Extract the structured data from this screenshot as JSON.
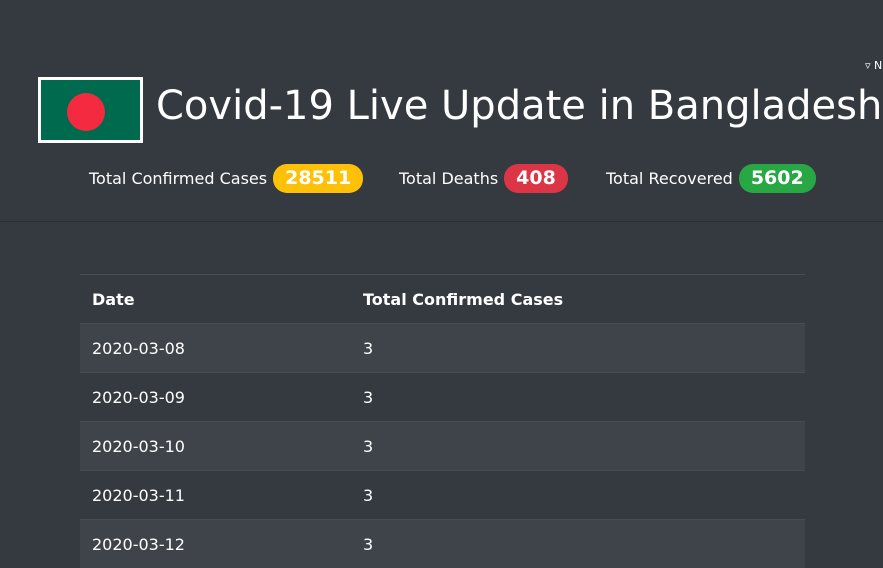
{
  "header": {
    "corner_menu": "▿ N",
    "title": "Covid-19 Live Update in Bangladesh"
  },
  "stats": {
    "confirmed": {
      "label": "Total Confirmed Cases",
      "value": "28511",
      "color": "#ffc107"
    },
    "deaths": {
      "label": "Total Deaths",
      "value": "408",
      "color": "#dc3545"
    },
    "recovered": {
      "label": "Total Recovered",
      "value": "5602",
      "color": "#28a745"
    }
  },
  "table": {
    "columns": [
      "Date",
      "Total Confirmed Cases"
    ],
    "rows": [
      [
        "2020-03-08",
        "3"
      ],
      [
        "2020-03-09",
        "3"
      ],
      [
        "2020-03-10",
        "3"
      ],
      [
        "2020-03-11",
        "3"
      ],
      [
        "2020-03-12",
        "3"
      ]
    ]
  },
  "colors": {
    "background": "#343a40",
    "flag_green": "#006a4e",
    "flag_red": "#f42a41"
  }
}
